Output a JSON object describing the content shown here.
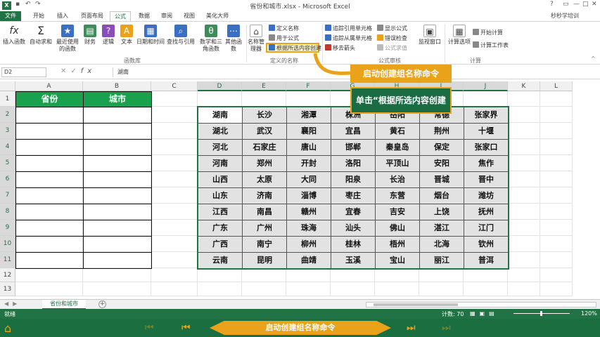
{
  "window": {
    "title": "省份和城市.xlsx - Microsoft Excel",
    "user": "秒秒学培训"
  },
  "tabs": [
    {
      "label": "文件"
    },
    {
      "label": "开始"
    },
    {
      "label": "插入"
    },
    {
      "label": "页面布局"
    },
    {
      "label": "公式"
    },
    {
      "label": "数据"
    },
    {
      "label": "审阅"
    },
    {
      "label": "视图"
    },
    {
      "label": "美化大师"
    }
  ],
  "ribbon": {
    "insert_function": "插入函数",
    "autosum": "自动求和",
    "recent": "最近使用的函数",
    "financial": "财务",
    "logical": "逻辑",
    "text": "文本",
    "datetime": "日期和时间",
    "lookup": "查找与引用",
    "math": "数学和三角函数",
    "more": "其他函数",
    "group_library": "函数库",
    "name_manager": "名称管理器",
    "define_name": "定义名称",
    "use_in_formula": "用于公式",
    "create_from_selection": "根据所选内容创建",
    "group_names": "定义的名称",
    "trace_precedents": "追踪引用单元格",
    "trace_dependents": "追踪从属单元格",
    "remove_arrows": "移去箭头",
    "show_formulas": "显示公式",
    "error_checking": "错误检查",
    "evaluate": "公式求值",
    "group_audit": "公式审核",
    "watch": "监视窗口",
    "calc_options": "计算选项",
    "calc_now": "开始计算",
    "calc_sheet": "计算工作表",
    "group_calc": "计算"
  },
  "formula_bar": {
    "name_box": "D2",
    "fx": "fx",
    "value": "湖南"
  },
  "columns": [
    "A",
    "B",
    "C",
    "D",
    "E",
    "F",
    "G",
    "H",
    "I",
    "J",
    "K",
    "L"
  ],
  "rows": [
    "1",
    "2",
    "3",
    "4",
    "5",
    "6",
    "7",
    "8",
    "9",
    "10",
    "11",
    "12",
    "13"
  ],
  "headers": {
    "a1": "省份",
    "b1": "城市"
  },
  "table": [
    [
      "湖南",
      "长沙",
      "湘潭",
      "株洲",
      "岳阳",
      "常德",
      "张家界"
    ],
    [
      "湖北",
      "武汉",
      "襄阳",
      "宜昌",
      "黄石",
      "荆州",
      "十堰"
    ],
    [
      "河北",
      "石家庄",
      "唐山",
      "邯郸",
      "秦皇岛",
      "保定",
      "张家口"
    ],
    [
      "河南",
      "郑州",
      "开封",
      "洛阳",
      "平顶山",
      "安阳",
      "焦作"
    ],
    [
      "山西",
      "太原",
      "大同",
      "阳泉",
      "长治",
      "晋城",
      "晋中"
    ],
    [
      "山东",
      "济南",
      "淄博",
      "枣庄",
      "东营",
      "烟台",
      "潍坊"
    ],
    [
      "江西",
      "南昌",
      "赣州",
      "宜春",
      "吉安",
      "上饶",
      "抚州"
    ],
    [
      "广东",
      "广州",
      "珠海",
      "汕头",
      "佛山",
      "湛江",
      "江门"
    ],
    [
      "广西",
      "南宁",
      "柳州",
      "桂林",
      "梧州",
      "北海",
      "钦州"
    ],
    [
      "云南",
      "昆明",
      "曲靖",
      "玉溪",
      "宝山",
      "丽江",
      "普洱"
    ]
  ],
  "callouts": {
    "title": "启动创建组名称命令",
    "instruction": "单击“根据所选内容创建"
  },
  "sheet_tab": "省份和城市",
  "status": {
    "ready": "就绪",
    "count": "计数: 70",
    "zoom": "120%"
  },
  "player": {
    "title": "启动创建组名称命令"
  },
  "colors": {
    "excel_green": "#217346",
    "header_green": "#1aa14e",
    "accent_gold": "#e9a21a"
  }
}
